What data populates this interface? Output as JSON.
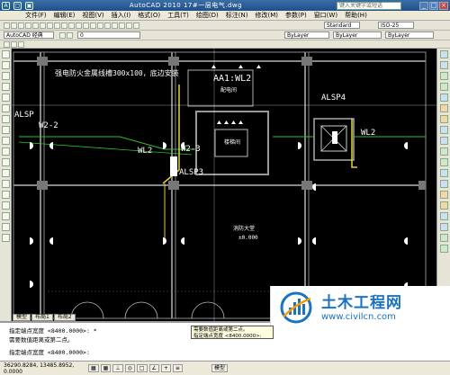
{
  "window": {
    "title": "AutoCAD 2010  17#一层电气.dwg",
    "search_placeholder": "键入关键字或短语",
    "min_label": "_",
    "max_label": "□",
    "close_label": "×"
  },
  "menu": [
    "文件(F)",
    "编辑(E)",
    "视图(V)",
    "插入(I)",
    "格式(O)",
    "工具(T)",
    "绘图(D)",
    "标注(N)",
    "修改(M)",
    "参数(P)",
    "窗口(W)",
    "帮助(H)"
  ],
  "toolbar": {
    "layer_value": "0",
    "style_value": "Standard",
    "dimstyle_value": "ISO-25",
    "color_value": "ByLayer",
    "linetype_value": "ByLayer",
    "lineweight_value": "ByLayer",
    "layer2_value": "AutoCAD 经典"
  },
  "drawing": {
    "labels": {
      "cable_tray": "强电防火金属线槽300x100，底边安装",
      "aa1": "AA1:WL2",
      "machine_room": "配电间",
      "alsp_left": "ALSP",
      "w2_2": "W2-2",
      "w2_3": "W2-3",
      "wl2_a": "WL2",
      "wl2_b": "WL2",
      "alsp3": "ALSP3",
      "alsp4": "ALSP4",
      "stair": "楼梯间",
      "hall": "消防大堂",
      "hall_elev": "±0.000"
    }
  },
  "layout_tabs": [
    "模型",
    "布局1",
    "布局2"
  ],
  "command": {
    "line1": "指定端点宽度 <8400.0000>: *",
    "line2": "需要数值距离或第二点。",
    "line3": "指定端点宽度 <8400.0000>:"
  },
  "tooltip": {
    "line1": "需要数值距离或第二点。",
    "line2": "指定端点宽度 <8400.0000>:"
  },
  "status": {
    "coords": "36290.8284, 13485.8952, 0.0000",
    "model": "模型"
  },
  "watermark": {
    "title": "土木工程网",
    "url": "www.civilcn.com"
  }
}
